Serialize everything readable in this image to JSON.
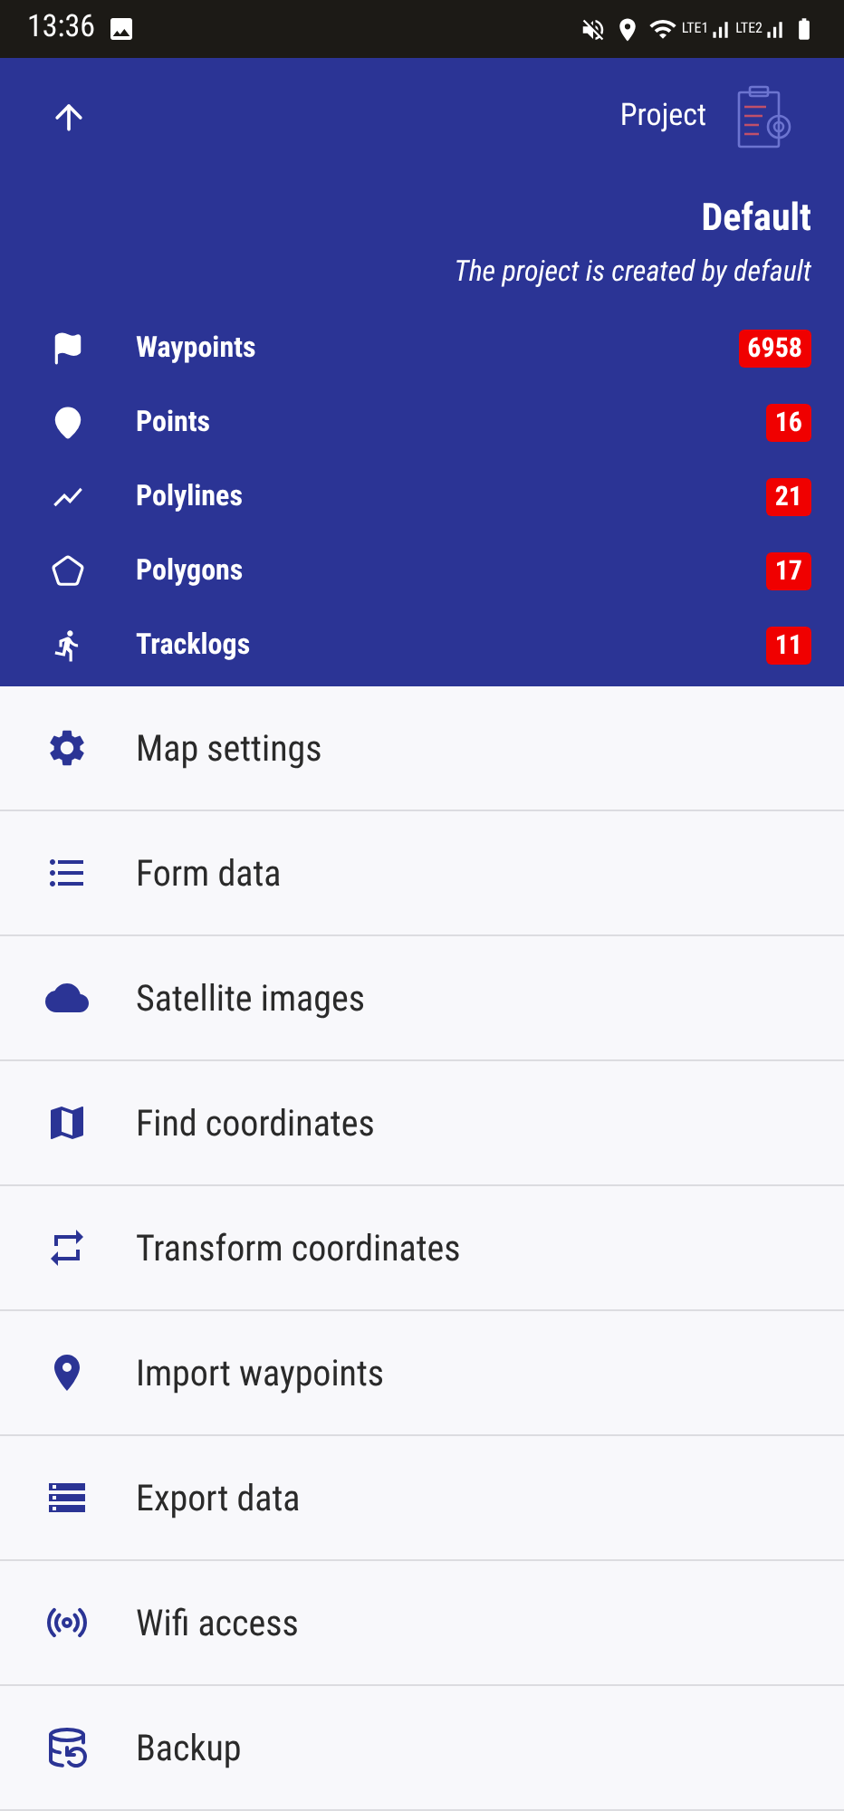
{
  "status_bar": {
    "time": "13:36",
    "sim_labels": [
      "LTE1",
      "LTE2"
    ]
  },
  "header": {
    "project_label": "Project",
    "project_name": "Default",
    "project_description": "The project is created by default"
  },
  "counts": [
    {
      "label": "Waypoints",
      "count": "6958"
    },
    {
      "label": "Points",
      "count": "16"
    },
    {
      "label": "Polylines",
      "count": "21"
    },
    {
      "label": "Polygons",
      "count": "17"
    },
    {
      "label": "Tracklogs",
      "count": "11"
    }
  ],
  "menu": [
    {
      "label": "Map settings"
    },
    {
      "label": "Form data"
    },
    {
      "label": "Satellite images"
    },
    {
      "label": "Find coordinates"
    },
    {
      "label": "Transform coordinates"
    },
    {
      "label": "Import waypoints"
    },
    {
      "label": "Export data"
    },
    {
      "label": "Wifi access"
    },
    {
      "label": "Backup"
    }
  ]
}
